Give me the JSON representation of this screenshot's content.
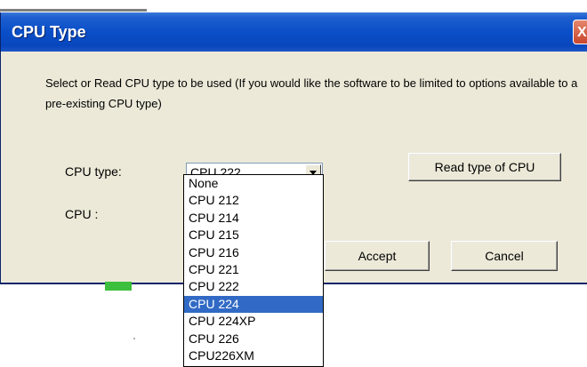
{
  "dialog": {
    "title": "CPU Type",
    "close_glyph": "X",
    "description": "Select or Read CPU type to be used (If you would like the software to be limited to options available to a pre-existing CPU type)"
  },
  "form": {
    "cpu_type_label": "CPU type:",
    "cpu_label": "CPU :",
    "cpu_type_selected": "CPU 222",
    "dropdown_icon": "chevron-down-icon"
  },
  "buttons": {
    "read_type": "Read type of CPU",
    "accept": "Accept",
    "cancel": "Cancel"
  },
  "dropdown": {
    "options": [
      "None",
      "CPU 212",
      "CPU 214",
      "CPU 215",
      "CPU 216",
      "CPU 221",
      "CPU 222",
      "CPU 224",
      "CPU 224XP",
      "CPU 226",
      "CPU226XM"
    ],
    "highlighted": "CPU 224"
  },
  "colors": {
    "titlebar": "#0a4fc8",
    "selection": "#316ac5",
    "dialog_bg": "#ece9d8"
  }
}
